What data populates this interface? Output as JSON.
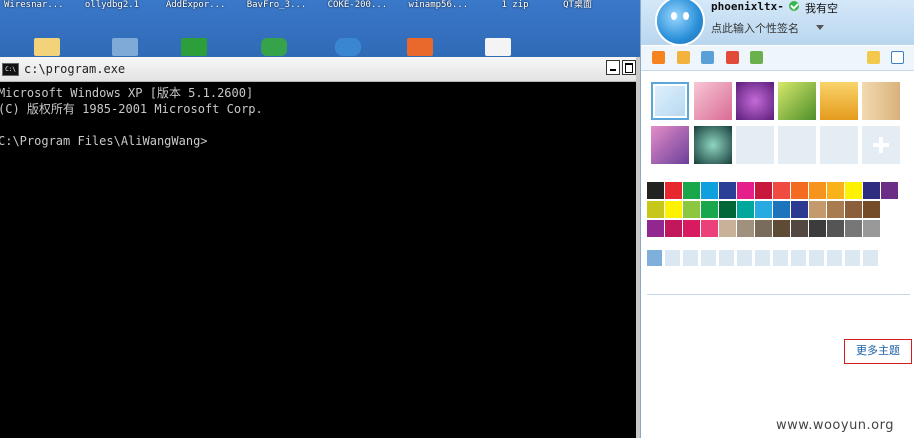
{
  "taskbar": {
    "items": [
      "Wiresnar...",
      "ollydbg2.1",
      "AddExpor...",
      "BavFro_3...",
      "COKE-200...",
      "winamp56...",
      "1 zip",
      "QT桌面"
    ]
  },
  "console": {
    "title": "c:\\program.exe",
    "icon_text": "C:\\",
    "lines": [
      "Microsoft Windows XP [版本 5.1.2600]",
      "(C) 版权所有 1985-2001 Microsoft Corp.",
      "",
      "C:\\Program Files\\AliWangWang>"
    ]
  },
  "im_panel": {
    "username": "phoenixltx-",
    "status": "我有空",
    "signature_placeholder": "点此输入个性签名",
    "toolbar_icons": [
      "taobao-icon",
      "mail-icon",
      "card-icon",
      "gift-icon",
      "app-icon",
      "chat-icon",
      "theme-icon"
    ],
    "more_themes": "更多主题",
    "swatch_colors": [
      [
        "#222222",
        "#e8262e",
        "#1aa64b",
        "#0fa0dd",
        "#2c3f96",
        "#e61e8c",
        "#c7173d",
        "#ef4b40",
        "#f36b21",
        "#f7941d",
        "#f9b21a",
        "#fff200",
        "#2f2d7f",
        "#6b2d86"
      ],
      [
        "#c7c61a",
        "#fff200",
        "#8dc63f",
        "#1aa64b",
        "#006838",
        "#00a79d",
        "#27aae1",
        "#1c75bc",
        "#2b3990",
        "#c49a6c",
        "#a97c50",
        "#8b5e3c",
        "#754c29"
      ],
      [
        "#92278f",
        "#c2185b",
        "#d81b60",
        "#ec407a",
        "#c7b299",
        "#a0917e",
        "#7a6c5c",
        "#5e4b36",
        "#534741",
        "#3c3c3c",
        "#555555",
        "#777777",
        "#999999"
      ]
    ]
  },
  "watermark": "www.wooyun.org"
}
